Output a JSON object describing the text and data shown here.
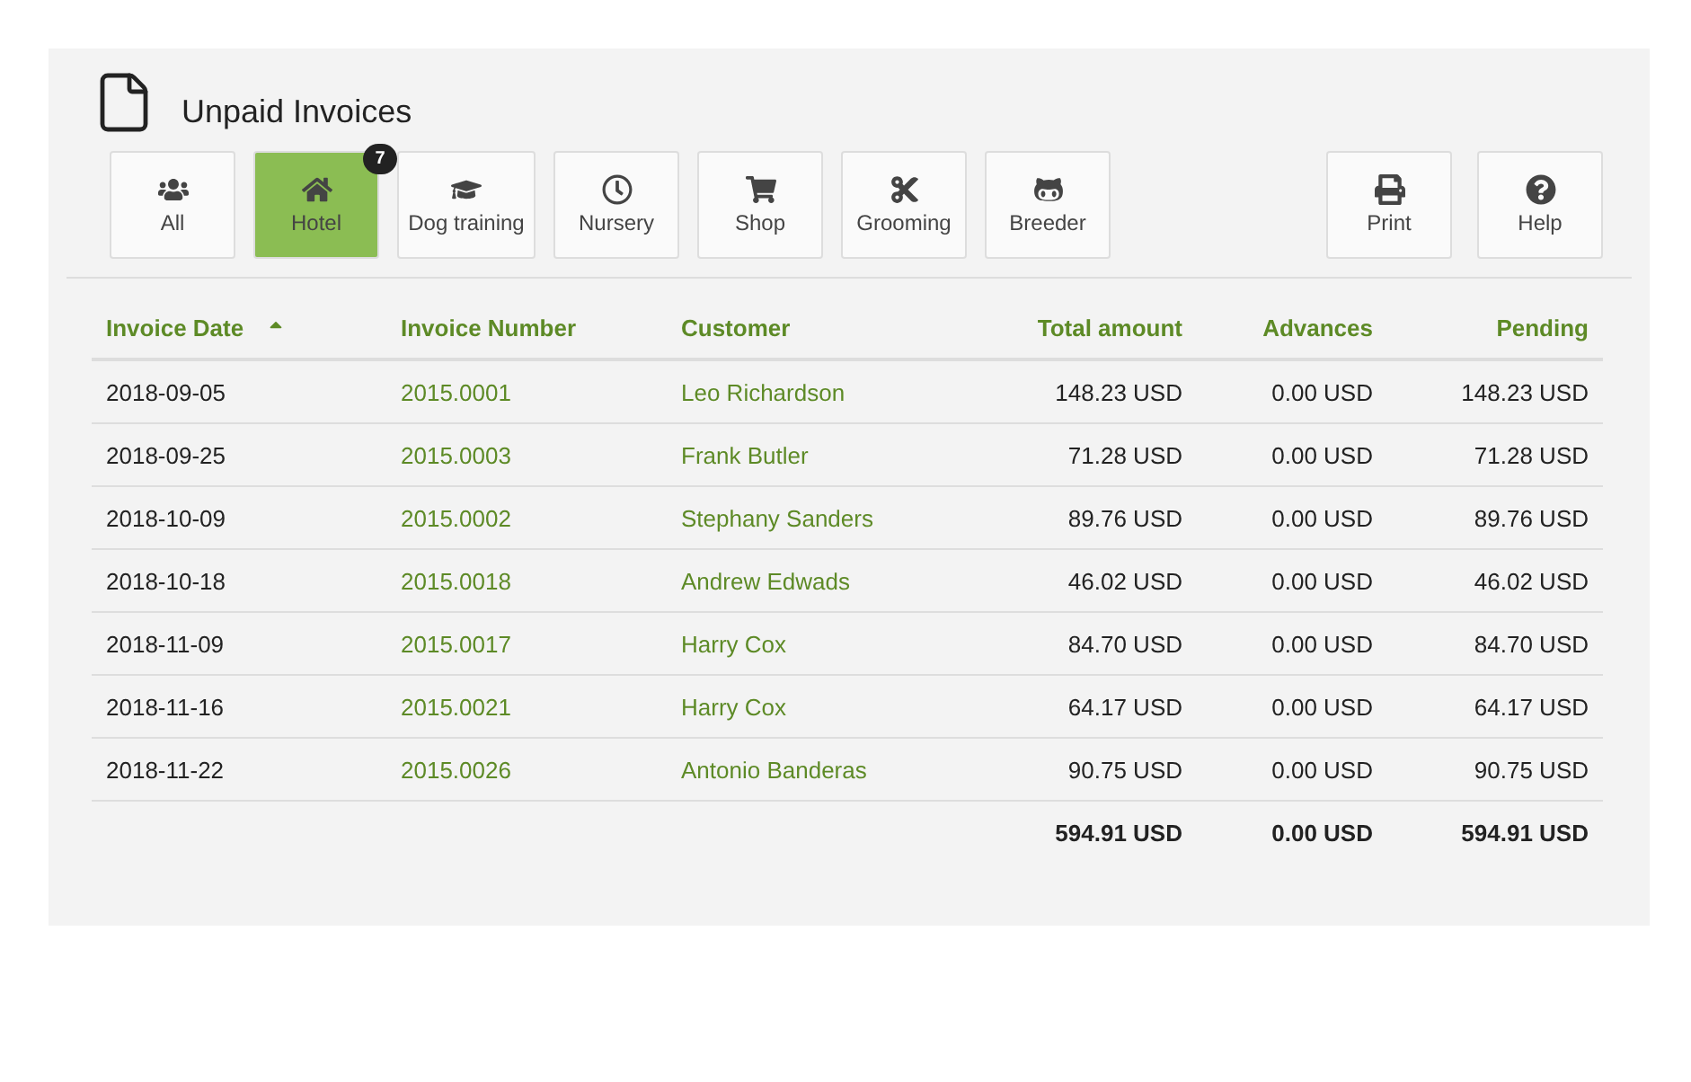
{
  "title": "Unpaid Invoices",
  "filters": [
    {
      "label": "All",
      "selected": false
    },
    {
      "label": "Hotel",
      "selected": true,
      "badge": "7"
    },
    {
      "label": "Dog training",
      "selected": false
    },
    {
      "label": "Nursery",
      "selected": false
    },
    {
      "label": "Shop",
      "selected": false
    },
    {
      "label": "Grooming",
      "selected": false
    },
    {
      "label": "Breeder",
      "selected": false
    }
  ],
  "actions": [
    {
      "label": "Print"
    },
    {
      "label": "Help"
    }
  ],
  "table": {
    "columns": [
      {
        "label": "Invoice Date",
        "sorted": true,
        "numeric": false
      },
      {
        "label": "Invoice Number",
        "sorted": false,
        "numeric": false
      },
      {
        "label": "Customer",
        "sorted": false,
        "numeric": false
      },
      {
        "label": "Total amount",
        "sorted": false,
        "numeric": true
      },
      {
        "label": "Advances",
        "sorted": false,
        "numeric": true
      },
      {
        "label": "Pending",
        "sorted": false,
        "numeric": true
      }
    ],
    "rows": [
      [
        "2018-09-05",
        "2015.0001",
        "Leo Richardson",
        "148.23 USD",
        "0.00 USD",
        "148.23 USD"
      ],
      [
        "2018-09-25",
        "2015.0003",
        "Frank Butler",
        "71.28 USD",
        "0.00 USD",
        "71.28 USD"
      ],
      [
        "2018-10-09",
        "2015.0002",
        "Stephany Sanders",
        "89.76 USD",
        "0.00 USD",
        "89.76 USD"
      ],
      [
        "2018-10-18",
        "2015.0018",
        "Andrew Edwads",
        "46.02 USD",
        "0.00 USD",
        "46.02 USD"
      ],
      [
        "2018-11-09",
        "2015.0017",
        "Harry Cox",
        "84.70 USD",
        "0.00 USD",
        "84.70 USD"
      ],
      [
        "2018-11-16",
        "2015.0021",
        "Harry Cox",
        "64.17 USD",
        "0.00 USD",
        "64.17 USD"
      ],
      [
        "2018-11-22",
        "2015.0026",
        "Antonio Banderas",
        "90.75 USD",
        "0.00 USD",
        "90.75 USD"
      ]
    ],
    "totals": [
      "594.91 USD",
      "0.00 USD",
      "594.91 USD"
    ]
  }
}
